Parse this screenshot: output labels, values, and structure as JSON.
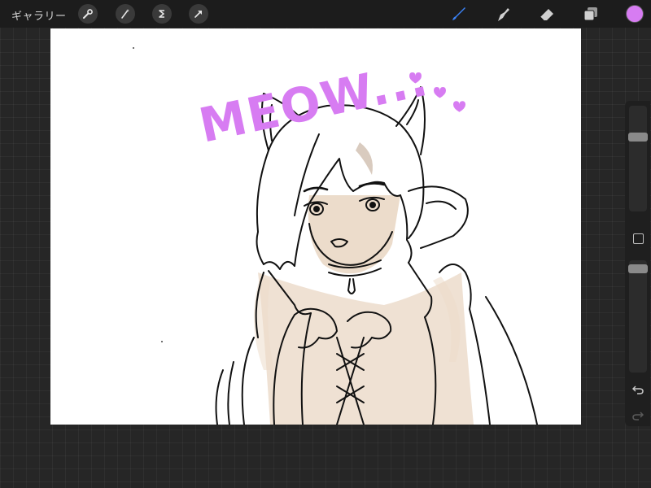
{
  "topbar": {
    "gallery_label": "ギャラリー",
    "left_tools": [
      {
        "icon": "wrench-icon",
        "name": "actions"
      },
      {
        "icon": "magic-wand-icon",
        "name": "adjustments"
      },
      {
        "icon": "selection-s-icon",
        "name": "selection"
      },
      {
        "icon": "arrow-cursor-icon",
        "name": "transform"
      }
    ],
    "right_tools": [
      {
        "icon": "brush-icon",
        "name": "paint",
        "active": true
      },
      {
        "icon": "smudge-icon",
        "name": "smudge"
      },
      {
        "icon": "eraser-icon",
        "name": "erase"
      },
      {
        "icon": "layers-icon",
        "name": "layers"
      }
    ],
    "current_color": "#d77cf2"
  },
  "sidebar": {
    "brush_size_level": 0.72,
    "opacity_level": 0.96
  },
  "canvas": {
    "handwritten_text": "MEOW...",
    "text_color": "#d77cf2",
    "skin_tone": "#ecdccb",
    "line_color": "#111111"
  }
}
